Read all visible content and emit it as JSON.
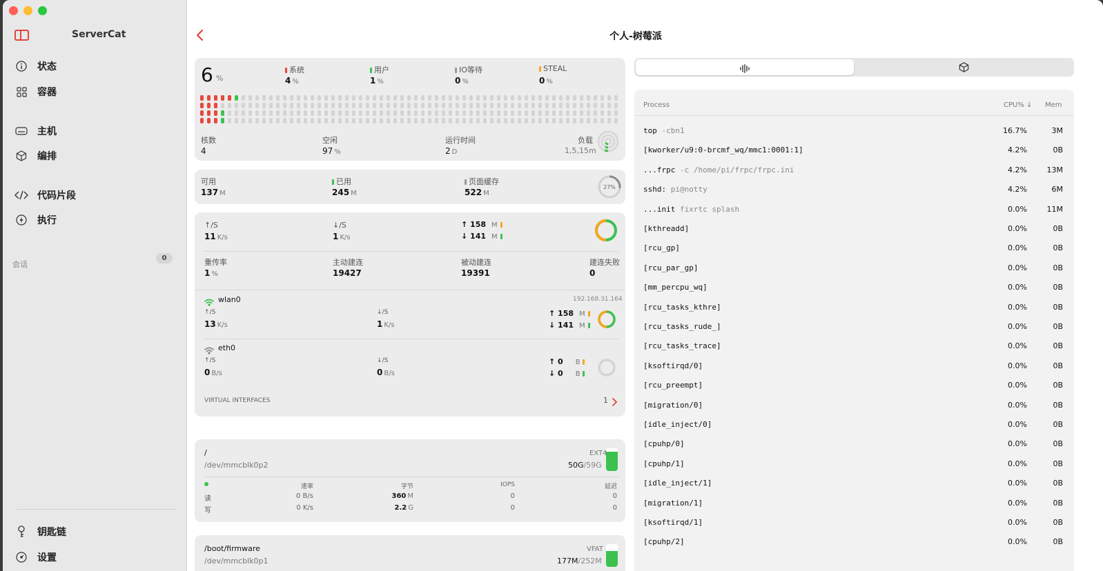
{
  "sidebar": {
    "app_title": "ServerCat",
    "nav": [
      {
        "label": "状态"
      },
      {
        "label": "容器"
      },
      {
        "label": "主机"
      },
      {
        "label": "编排"
      },
      {
        "label": "代码片段"
      },
      {
        "label": "执行"
      }
    ],
    "sessions_label": "会话",
    "sessions_count": "0",
    "bottom": [
      {
        "label": "钥匙链"
      },
      {
        "label": "设置"
      }
    ]
  },
  "header": {
    "title": "个人-树莓派"
  },
  "cpu": {
    "usage": "6",
    "usage_unit": "%",
    "stats": [
      {
        "label": "系统",
        "value": "4",
        "unit": "%",
        "color": "#e9463c"
      },
      {
        "label": "用户",
        "value": "1",
        "unit": "%",
        "color": "#3cc150"
      },
      {
        "label": "IO等待",
        "value": "0",
        "unit": "%",
        "color": "#999999"
      },
      {
        "label": "STEAL",
        "value": "0",
        "unit": "%",
        "color": "#f5a623"
      }
    ],
    "cores_label": "核数",
    "cores": "4",
    "idle_label": "空闲",
    "idle": "97",
    "idle_unit": "%",
    "uptime_label": "运行时间",
    "uptime": "2",
    "uptime_unit": "D",
    "load_label": "负载",
    "load": "1,5,15m",
    "core_bars": [
      {
        "red": 5,
        "green": 1
      },
      {
        "red": 3,
        "green": 0
      },
      {
        "red": 3,
        "green": 1
      },
      {
        "red": 3,
        "green": 1
      }
    ]
  },
  "memory": {
    "available_label": "可用",
    "available": "137",
    "available_unit": "M",
    "used_label": "已用",
    "used": "245",
    "used_unit": "M",
    "cache_label": "页面缓存",
    "cache": "522",
    "cache_unit": "M",
    "ring_text": "27%",
    "ring_fraction": 0.27
  },
  "network": {
    "up_label": "↑/S",
    "up": "11",
    "up_unit": "K/s",
    "down_label": "↓/S",
    "down": "1",
    "down_unit": "K/s",
    "total_up": "158",
    "total_up_unit": "M",
    "total_down": "141",
    "total_down_unit": "M",
    "retrans_label": "重传率",
    "retrans": "1",
    "retrans_unit": "%",
    "active_label": "主动建连",
    "active": "19427",
    "passive_label": "被动建连",
    "passive": "19391",
    "fail_label": "建连失败",
    "fail": "0",
    "interfaces": [
      {
        "name": "wlan0",
        "ip": "192.168.31.164",
        "up_label": "↑/S",
        "up": "13",
        "up_unit": "K/s",
        "down_label": "↓/S",
        "down": "1",
        "down_unit": "K/s",
        "total_up": "158",
        "total_up_unit": "M",
        "total_down": "141",
        "total_down_unit": "M"
      },
      {
        "name": "eth0",
        "ip": "",
        "up_label": "↑/S",
        "up": "0",
        "up_unit": "B/s",
        "down_label": "↓/S",
        "down": "0",
        "down_unit": "B/s",
        "total_up": "0",
        "total_up_unit": "B",
        "total_down": "0",
        "total_down_unit": "B"
      }
    ],
    "virtual_label": "VIRTUAL INTERFACES",
    "virtual_count": "1"
  },
  "disks": [
    {
      "mount": "/",
      "device": "/dev/mmcblk0p2",
      "fs": "EXT4",
      "used": "50G",
      "total": "/59G",
      "fill": 0.85,
      "rate_label": "速率",
      "bytes_label": "字节",
      "iops_label": "IOPS",
      "latency_label": "延迟",
      "read_label": "读",
      "read_rate": "0 B/s",
      "read_bytes": "360",
      "read_bytes_unit": "M",
      "read_iops": "0",
      "read_latency": "0",
      "write_label": "写",
      "write_rate": "0 K/s",
      "write_bytes": "2.2",
      "write_bytes_unit": "G",
      "write_iops": "0",
      "write_latency": "0"
    },
    {
      "mount": "/boot/firmware",
      "device": "/dev/mmcblk0p1",
      "fs": "VFAT",
      "used": "177M",
      "total": "/252M",
      "fill": 0.7
    }
  ],
  "process_table": {
    "headers": {
      "process": "Process",
      "cpu": "CPU% ↓",
      "mem": "Mem"
    },
    "rows": [
      {
        "cmd": "top",
        "args": " -cbn1",
        "cpu": "16.7%",
        "mem": "3M"
      },
      {
        "cmd": "[kworker/u9:0-brcmf_wq/mmc1:0001:1]",
        "args": "",
        "cpu": "4.2%",
        "mem": "0B"
      },
      {
        "cmd": "...frpc",
        "args": " -c /home/pi/frpc/frpc.ini",
        "cpu": "4.2%",
        "mem": "13M"
      },
      {
        "cmd": "sshd:",
        "args": " pi@notty",
        "cpu": "4.2%",
        "mem": "6M"
      },
      {
        "cmd": "...init",
        "args": " fixrtc splash",
        "cpu": "0.0%",
        "mem": "11M"
      },
      {
        "cmd": "[kthreadd]",
        "args": "",
        "cpu": "0.0%",
        "mem": "0B"
      },
      {
        "cmd": "[rcu_gp]",
        "args": "",
        "cpu": "0.0%",
        "mem": "0B"
      },
      {
        "cmd": "[rcu_par_gp]",
        "args": "",
        "cpu": "0.0%",
        "mem": "0B"
      },
      {
        "cmd": "[mm_percpu_wq]",
        "args": "",
        "cpu": "0.0%",
        "mem": "0B"
      },
      {
        "cmd": "[rcu_tasks_kthre]",
        "args": "",
        "cpu": "0.0%",
        "mem": "0B"
      },
      {
        "cmd": "[rcu_tasks_rude_]",
        "args": "",
        "cpu": "0.0%",
        "mem": "0B"
      },
      {
        "cmd": "[rcu_tasks_trace]",
        "args": "",
        "cpu": "0.0%",
        "mem": "0B"
      },
      {
        "cmd": "[ksoftirqd/0]",
        "args": "",
        "cpu": "0.0%",
        "mem": "0B"
      },
      {
        "cmd": "[rcu_preempt]",
        "args": "",
        "cpu": "0.0%",
        "mem": "0B"
      },
      {
        "cmd": "[migration/0]",
        "args": "",
        "cpu": "0.0%",
        "mem": "0B"
      },
      {
        "cmd": "[idle_inject/0]",
        "args": "",
        "cpu": "0.0%",
        "mem": "0B"
      },
      {
        "cmd": "[cpuhp/0]",
        "args": "",
        "cpu": "0.0%",
        "mem": "0B"
      },
      {
        "cmd": "[cpuhp/1]",
        "args": "",
        "cpu": "0.0%",
        "mem": "0B"
      },
      {
        "cmd": "[idle_inject/1]",
        "args": "",
        "cpu": "0.0%",
        "mem": "0B"
      },
      {
        "cmd": "[migration/1]",
        "args": "",
        "cpu": "0.0%",
        "mem": "0B"
      },
      {
        "cmd": "[ksoftirqd/1]",
        "args": "",
        "cpu": "0.0%",
        "mem": "0B"
      },
      {
        "cmd": "[cpuhp/2]",
        "args": "",
        "cpu": "0.0%",
        "mem": "0B"
      }
    ]
  },
  "colors": {
    "accent": "#e0463d",
    "green": "#3cc150",
    "orange": "#f5a623",
    "red": "#e9463c"
  }
}
